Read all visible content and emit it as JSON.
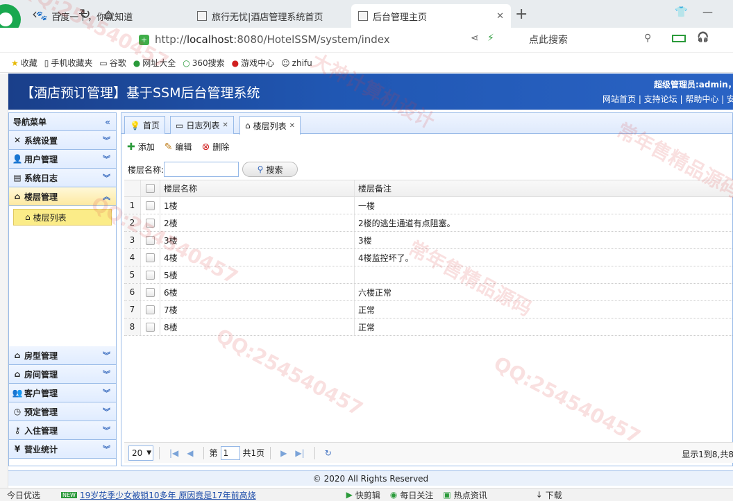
{
  "browser": {
    "tabs": [
      {
        "title": "百度一下，你就知道"
      },
      {
        "title": "旅行无忧|酒店管理系统首页"
      },
      {
        "title": "后台管理主页"
      }
    ],
    "url_prefix": "http://",
    "url_host": "localhost",
    "url_rest": ":8080/HotelSSM/system/index",
    "search_placeholder": "点此搜索",
    "bookmarks": [
      "收藏",
      "手机收藏夹",
      "谷歌",
      "网址大全",
      "360搜索",
      "游戏中心",
      "zhifu"
    ]
  },
  "header": {
    "title": "【酒店预订管理】基于SSM后台管理系统",
    "admin": "超级管理员:admin，",
    "links": "网站首页 | 支持论坛 | 帮助中心 | 安"
  },
  "sidebar": {
    "title": "导航菜单",
    "top_menus": [
      "系统设置",
      "用户管理",
      "系统日志",
      "楼层管理"
    ],
    "sub_item": "楼层列表",
    "bottom_menus": [
      "房型管理",
      "房间管理",
      "客户管理",
      "预定管理",
      "入住管理",
      "营业统计"
    ]
  },
  "content_tabs": [
    "首页",
    "日志列表",
    "楼层列表"
  ],
  "toolbar": {
    "add": "添加",
    "edit": "编辑",
    "delete": "删除"
  },
  "search": {
    "label": "楼层名称:",
    "button": "搜索"
  },
  "grid": {
    "headers": [
      "楼层名称",
      "楼层备注"
    ],
    "rows": [
      {
        "num": "1",
        "name": "1楼",
        "remark": "一楼"
      },
      {
        "num": "2",
        "name": "2楼",
        "remark": "2楼的逃生通道有点阻塞。"
      },
      {
        "num": "3",
        "name": "3楼",
        "remark": "3楼"
      },
      {
        "num": "4",
        "name": "4楼",
        "remark": "4楼监控坏了。"
      },
      {
        "num": "5",
        "name": "5楼",
        "remark": ""
      },
      {
        "num": "6",
        "name": "6楼",
        "remark": "六楼正常"
      },
      {
        "num": "7",
        "name": "7楼",
        "remark": "正常"
      },
      {
        "num": "8",
        "name": "8楼",
        "remark": "正常"
      }
    ]
  },
  "pager": {
    "page_size": "20",
    "page_label": "第",
    "page_num": "1",
    "total_pages": "共1页",
    "info": "显示1到8,共8"
  },
  "footer": "© 2020 All Rights Reserved",
  "statusbar": {
    "left": "今日优选",
    "badge": "NEW",
    "news": "19岁花季少女被锁10多年 原因竟是17年前高烧",
    "items": [
      "快剪辑",
      "每日关注",
      "热点资讯",
      "下载"
    ]
  },
  "watermarks": [
    "QQ:254540457",
    "大神计算机设计",
    "常年售精品源码"
  ]
}
